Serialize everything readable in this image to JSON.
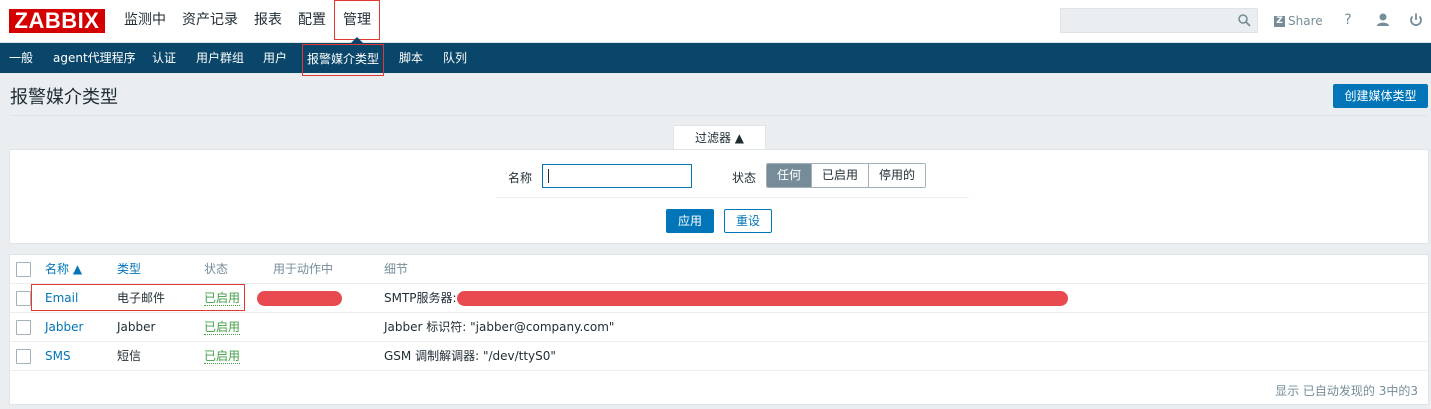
{
  "header": {
    "logo": "ZABBIX",
    "menu": [
      {
        "label": "监测中"
      },
      {
        "label": "资产记录"
      },
      {
        "label": "报表"
      },
      {
        "label": "配置"
      },
      {
        "label": "管理",
        "active": true
      }
    ],
    "search_placeholder": "",
    "share_label": "Share",
    "share_icon": "Z",
    "help_icon": "?",
    "user_icon": "user-icon",
    "logout_icon": "power-icon"
  },
  "subnav": {
    "items": [
      {
        "label": "一般"
      },
      {
        "label": "agent代理程序"
      },
      {
        "label": "认证"
      },
      {
        "label": "用户群组"
      },
      {
        "label": "用户"
      },
      {
        "label": "报警媒介类型",
        "active": true
      },
      {
        "label": "脚本"
      },
      {
        "label": "队列"
      }
    ]
  },
  "page": {
    "title": "报警媒介类型",
    "create_button": "创建媒体类型"
  },
  "filter": {
    "tab_label": "过滤器 ▲",
    "name_label": "名称",
    "name_value": "",
    "status_label": "状态",
    "status_options": [
      "任何",
      "已启用",
      "停用的"
    ],
    "status_selected": "任何",
    "apply_label": "应用",
    "reset_label": "重设"
  },
  "table": {
    "headers": {
      "name": "名称 ▲",
      "type": "类型",
      "status": "状态",
      "used_in_actions": "用于动作中",
      "details": "细节"
    },
    "rows": [
      {
        "name": "Email",
        "type": "电子邮件",
        "status": "已启用",
        "details": "SMTP服务器: "
      },
      {
        "name": "Jabber",
        "type": "Jabber",
        "status": "已启用",
        "details": "Jabber 标识符: \"jabber@company.com\""
      },
      {
        "name": "SMS",
        "type": "短信",
        "status": "已启用",
        "details": "GSM 调制解调器: \"/dev/ttyS0\""
      }
    ],
    "footer": "显示 已自动发现的 3中的3"
  },
  "colors": {
    "brand": "#d40000",
    "nav_bg": "#0a466a",
    "accent": "#0275b8",
    "enabled": "#429e47",
    "redaction": "#e84a50"
  }
}
